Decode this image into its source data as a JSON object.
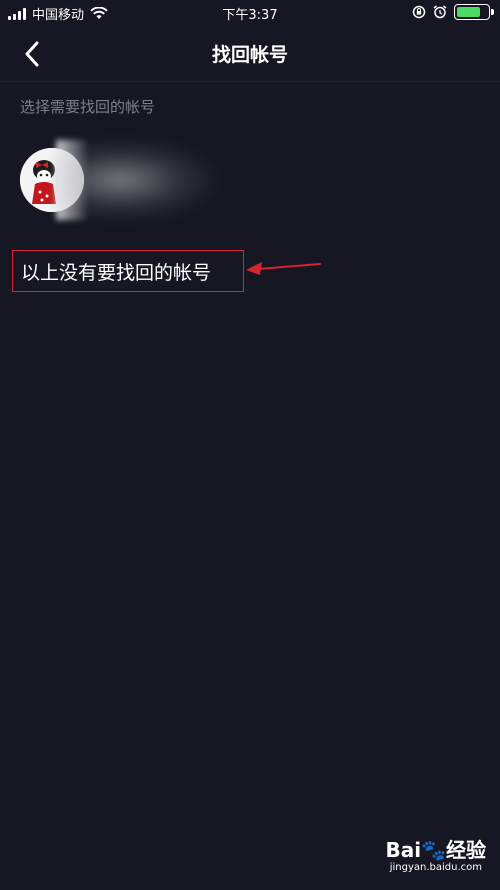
{
  "status_bar": {
    "carrier": "中国移动",
    "time": "下午3:37",
    "battery_level": 0.8
  },
  "nav": {
    "title": "找回帐号",
    "back_icon": "chevron-left-icon"
  },
  "hint": "选择需要找回的帐号",
  "account": {
    "avatar_icon": "avatar-cartoon-icon"
  },
  "no_account_link": "以上没有要找回的帐号",
  "annotation": {
    "color": "#d7232e"
  },
  "watermark": {
    "logo": "Bai🐾经验",
    "url": "jingyan.baidu.com"
  },
  "colors": {
    "background": "#161722",
    "hint_text": "#7d7f88",
    "battery": "#4cd964"
  }
}
